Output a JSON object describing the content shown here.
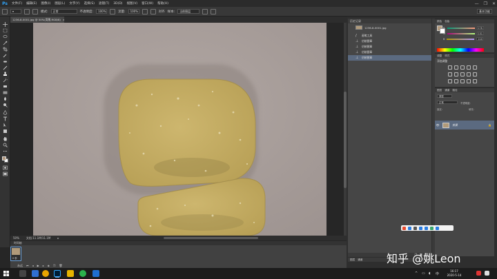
{
  "app": {
    "logo": "Ps",
    "menu": [
      "文件(F)",
      "编辑(E)",
      "图像(I)",
      "图层(L)",
      "文字(Y)",
      "选择(S)",
      "滤镜(T)",
      "3D(D)",
      "视图(V)",
      "窗口(W)",
      "帮助(H)"
    ],
    "window_controls": [
      "—",
      "❐",
      "✕"
    ]
  },
  "options_bar": {
    "mode_label": "模式:",
    "mode_value": "正常",
    "opacity_label": "不透明度:",
    "opacity_value": "100%",
    "flow_label": "流量:",
    "flow_value": "100%",
    "align_label": "对齐",
    "sample_label": "样本:",
    "sample_value": "当前图层",
    "workspace": "基本功能"
  },
  "document": {
    "tab_title": "1236-8-0001.jpg @ 50%(背景,RGB/8)",
    "status_zoom": "50%",
    "status_doc": "文档:11.1M/11.1M"
  },
  "timeline": {
    "tab_label": "时间轴",
    "frame_label": "0 秒",
    "loop_label": "永远"
  },
  "history": {
    "tab_label": "历史记录",
    "snapshot_name": "1236-8-0001.jpg",
    "items": [
      {
        "label": "画笔工具",
        "icon": "brush-icon"
      },
      {
        "label": "仿制图章",
        "icon": "stamp-icon"
      },
      {
        "label": "仿制图章",
        "icon": "stamp-icon"
      },
      {
        "label": "仿制图章",
        "icon": "stamp-icon"
      },
      {
        "label": "仿制图章",
        "icon": "stamp-icon",
        "selected": true
      }
    ],
    "bottom_tabs": [
      "图层",
      "通道"
    ]
  },
  "color_panel": {
    "tabs": [
      "颜色",
      "色板"
    ],
    "channels": [
      {
        "name": "R",
        "value": "178"
      },
      {
        "name": "G",
        "value": "151"
      },
      {
        "name": "B",
        "value": "124"
      }
    ],
    "foreground": "#b2977c",
    "background": "#ffffff"
  },
  "adjustments_panel": {
    "tabs": [
      "调整",
      "样式"
    ],
    "title": "添加调整"
  },
  "layers_panel": {
    "tabs": [
      "图层",
      "通道",
      "路径"
    ],
    "kind_label": "类型",
    "blend_mode": "正常",
    "opacity_label": "不透明度:",
    "lock_label": "锁定:",
    "fill_label": "填充:",
    "layer_name": "背景"
  },
  "watermark": "知乎 @姚Leon",
  "taskbar": {
    "time": "16:17",
    "date": "2020-5-14"
  },
  "colors": {
    "canvas_bg": "#a99f9b",
    "soap": "#c6b06a",
    "selected_row": "#5b6a80",
    "accent": "#31a8ff"
  }
}
